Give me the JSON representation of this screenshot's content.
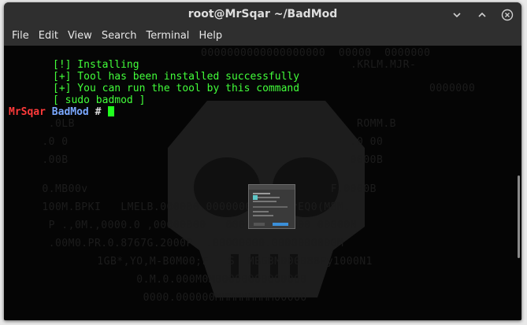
{
  "window": {
    "title": "root@MrSqar ~/BadMod",
    "controls": [
      "minimize-icon",
      "maximize-icon",
      "close-icon"
    ]
  },
  "menu": [
    "File",
    "Edit",
    "View",
    "Search",
    "Terminal",
    "Help"
  ],
  "terminal": {
    "lines": [
      "[!] Installing",
      "[+] Tool has been installed successfully",
      "[+] You can run the tool by this command",
      "[ sudo badmod ]"
    ],
    "prompt": {
      "host": "MrSqar",
      "dir": "BadMod",
      "symbol": "#"
    }
  },
  "colors": {
    "output": "#42ff3a",
    "host": "#ff3a3a",
    "dir": "#7aa8ff",
    "background": "#050505"
  }
}
